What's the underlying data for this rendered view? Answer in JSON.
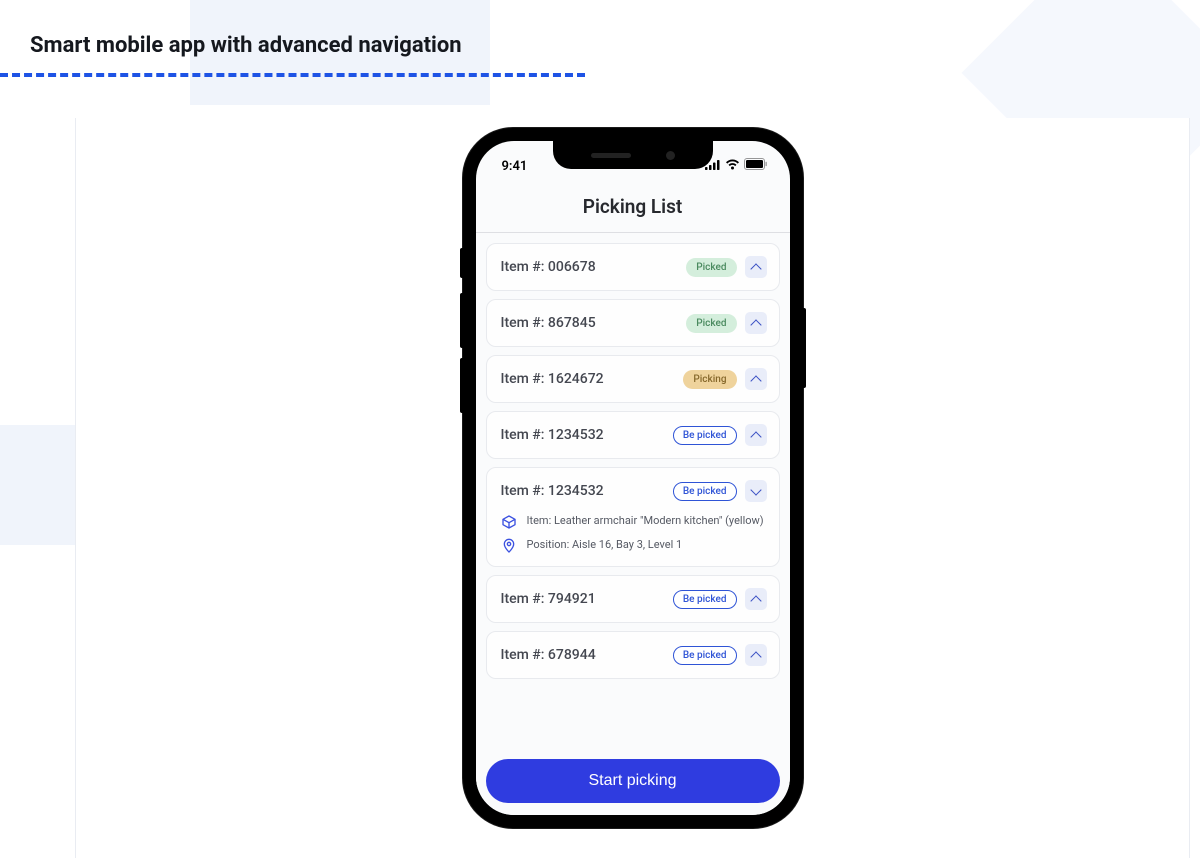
{
  "page_heading": "Smart mobile app with advanced navigation",
  "status_bar": {
    "time": "9:41"
  },
  "app_header": "Picking List",
  "items": [
    {
      "label": "Item #: 006678",
      "status": "Picked",
      "status_type": "picked",
      "expanded": false
    },
    {
      "label": "Item #: 867845",
      "status": "Picked",
      "status_type": "picked",
      "expanded": false
    },
    {
      "label": "Item #: 1624672",
      "status": "Picking",
      "status_type": "picking",
      "expanded": false
    },
    {
      "label": "Item #: 1234532",
      "status": "Be picked",
      "status_type": "bepicked",
      "expanded": false
    },
    {
      "label": "Item #: 1234532",
      "status": "Be picked",
      "status_type": "bepicked",
      "expanded": true,
      "detail_item": "Item: Leather armchair \"Modern kitchen\" (yellow)",
      "detail_position": "Position: Aisle 16, Bay 3, Level 1"
    },
    {
      "label": "Item #: 794921",
      "status": "Be picked",
      "status_type": "bepicked",
      "expanded": false
    },
    {
      "label": "Item #: 678944",
      "status": "Be picked",
      "status_type": "bepicked",
      "expanded": false
    }
  ],
  "primary_action": "Start picking"
}
